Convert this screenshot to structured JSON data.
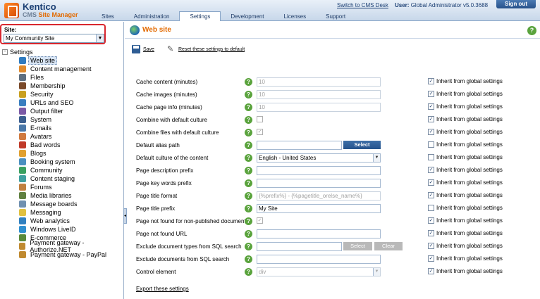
{
  "header": {
    "brand": "Kentico",
    "product_prefix": "CMS",
    "product_suffix": "Site Manager",
    "tabs": [
      {
        "label": "Sites",
        "active": false
      },
      {
        "label": "Administration",
        "active": false
      },
      {
        "label": "Settings",
        "active": true
      },
      {
        "label": "Development",
        "active": false
      },
      {
        "label": "Licenses",
        "active": false
      },
      {
        "label": "Support",
        "active": false
      }
    ],
    "switch_link": "Switch to CMS Desk",
    "user_label": "User:",
    "user_name": "Global Administrator",
    "version": "v5.0.3688",
    "sign_out": "Sign out"
  },
  "sidebar": {
    "site_label": "Site:",
    "site_value": "My Community Site",
    "tree_root": "Settings",
    "items": [
      {
        "label": "Web site",
        "icon": "globe-icon",
        "color": "#2f7bc0"
      },
      {
        "label": "Content management",
        "icon": "content-icon",
        "color": "#e08a2c"
      },
      {
        "label": "Files",
        "icon": "files-icon",
        "color": "#5f6f80"
      },
      {
        "label": "Membership",
        "icon": "membership-icon",
        "color": "#7a4a2a"
      },
      {
        "label": "Security",
        "icon": "security-icon",
        "color": "#c9a020"
      },
      {
        "label": "URLs and SEO",
        "icon": "urls-icon",
        "color": "#3a7fc0"
      },
      {
        "label": "Output filter",
        "icon": "filter-icon",
        "color": "#7b5aa6"
      },
      {
        "label": "System",
        "icon": "system-icon",
        "color": "#3b5f8f"
      },
      {
        "label": "E-mails",
        "icon": "email-icon",
        "color": "#4a78a8"
      },
      {
        "label": "Avatars",
        "icon": "avatar-icon",
        "color": "#d07a40"
      },
      {
        "label": "Bad words",
        "icon": "bad-words-icon",
        "color": "#c03a2a"
      },
      {
        "label": "Blogs",
        "icon": "blog-icon",
        "color": "#e0a030"
      },
      {
        "label": "Booking system",
        "icon": "booking-icon",
        "color": "#4a8fc0"
      },
      {
        "label": "Community",
        "icon": "community-icon",
        "color": "#3aa060"
      },
      {
        "label": "Content staging",
        "icon": "staging-icon",
        "color": "#40a0a0"
      },
      {
        "label": "Forums",
        "icon": "forums-icon",
        "color": "#c08040"
      },
      {
        "label": "Media libraries",
        "icon": "media-icon",
        "color": "#608040"
      },
      {
        "label": "Message boards",
        "icon": "message-board-icon",
        "color": "#7090b0"
      },
      {
        "label": "Messaging",
        "icon": "messaging-icon",
        "color": "#e0c040"
      },
      {
        "label": "Web analytics",
        "icon": "analytics-icon",
        "color": "#3080c0"
      },
      {
        "label": "Windows LiveID",
        "icon": "liveid-icon",
        "color": "#2f8fd0"
      },
      {
        "label": "E-commerce",
        "icon": "ecommerce-icon",
        "color": "#5a8a3a"
      },
      {
        "label": "Payment gateway - Authorize.NET",
        "icon": "payment-icon",
        "color": "#c08a30"
      },
      {
        "label": "Payment gateway - PayPal",
        "icon": "payment-icon",
        "color": "#c08a30"
      }
    ]
  },
  "main": {
    "title": "Web site",
    "help_glyph": "?",
    "save_label": "Save",
    "reset_label": "Reset these settings to default",
    "inherit_label": "Inherit from global settings",
    "select_label": "Select",
    "clear_label": "Clear",
    "export_label": "Export these settings",
    "rows": [
      {
        "label": "Cache content (minutes)",
        "value": "10",
        "inherit": true
      },
      {
        "label": "Cache images (minutes)",
        "value": "10",
        "inherit": true
      },
      {
        "label": "Cache page info (minutes)",
        "value": "10",
        "inherit": true
      },
      {
        "label": "Combine with default culture",
        "checked": false,
        "inherit": true
      },
      {
        "label": "Combine files with default culture",
        "checked": true,
        "inherit": true
      },
      {
        "label": "Default alias path",
        "value": "",
        "inherit": false
      },
      {
        "label": "Default culture of the content",
        "value": "English - United States",
        "inherit": false
      },
      {
        "label": "Page description prefix",
        "value": "",
        "inherit": true
      },
      {
        "label": "Page key words prefix",
        "value": "",
        "inherit": true
      },
      {
        "label": "Page title format",
        "value": "{%prefix%} - {%pagetitle_orelse_name%}",
        "inherit": true
      },
      {
        "label": "Page title prefix",
        "value": "My Site",
        "inherit": false
      },
      {
        "label": "Page not found for non-published documents",
        "checked": true,
        "inherit": true
      },
      {
        "label": "Page not found URL",
        "value": "",
        "inherit": true
      },
      {
        "label": "Exclude document types from SQL search",
        "value": "",
        "inherit": true
      },
      {
        "label": "Exclude documents from SQL search",
        "value": "",
        "inherit": true
      },
      {
        "label": "Control element",
        "value": "div",
        "inherit": true
      }
    ]
  }
}
